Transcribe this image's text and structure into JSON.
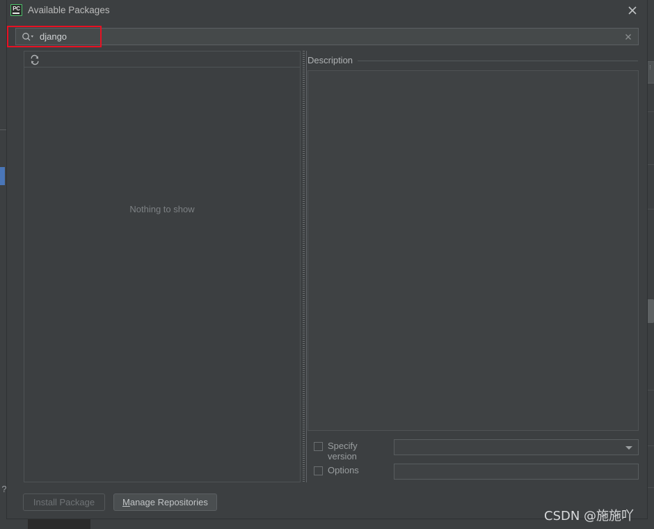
{
  "window": {
    "title": "Available Packages",
    "app_icon": "pycharm-icon",
    "app_icon_text": "PC",
    "close_label": "×"
  },
  "search": {
    "value": "django",
    "placeholder": "",
    "icon": "search-icon",
    "clear_icon": "clear-icon"
  },
  "annotation": {
    "color": "#e81123",
    "target": "search-field"
  },
  "packages_panel": {
    "refresh_icon": "refresh-icon",
    "empty_text": "Nothing to show",
    "items": []
  },
  "description_panel": {
    "title": "Description",
    "body": ""
  },
  "options": {
    "specify_version": {
      "label": "Specify version",
      "checked": false,
      "value": "",
      "control": "combobox"
    },
    "options_field": {
      "label": "Options",
      "checked": false,
      "value": "",
      "control": "textfield"
    }
  },
  "buttons": {
    "install": {
      "label": "Install Package",
      "enabled": false
    },
    "manage": {
      "label": "Manage Repositories",
      "mnemonic": "M",
      "rest": "anage Repositories",
      "enabled": true
    }
  },
  "watermark": {
    "text": "CSDN @施施吖"
  },
  "background": {
    "help_icon": "question-mark-icon"
  },
  "colors": {
    "dialog_bg": "#3c3f41",
    "panel_bg": "#3f4244",
    "field_bg": "#45494a",
    "border": "#5c6063",
    "text": "#bbbbbb",
    "muted_text": "#7d8184",
    "accent_red": "#e81123",
    "accent_blue": "#4a76b8",
    "icon_green": "#4ec36b"
  }
}
